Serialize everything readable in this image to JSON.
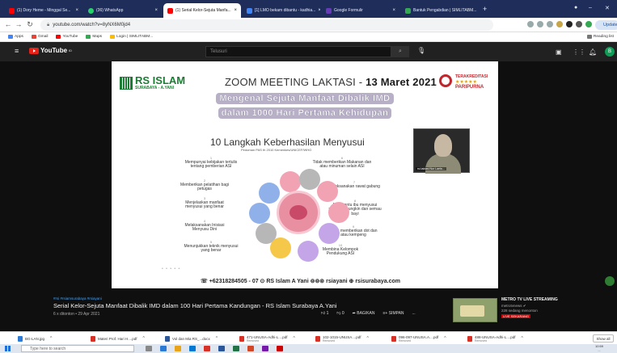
{
  "tabs": [
    {
      "label": "(1) Dory Heme - Minggal Se...",
      "icon_color": "#ff0000",
      "active": false
    },
    {
      "label": "(36) WhatsApp",
      "icon_color": "#25d366",
      "active": false
    },
    {
      "label": "(1) Serial Kelor-Sejuta Manfa...",
      "icon_color": "#ff0000",
      "active": true
    },
    {
      "label": "[1] LMO bekam dibantu - kadhia...",
      "icon_color": "#4285f4",
      "active": false
    },
    {
      "label": "Google Formulir",
      "icon_color": "#673ab7",
      "active": false
    },
    {
      "label": "Bantuk Pengabdian | SIMLITABM...",
      "icon_color": "#34a853",
      "active": false
    }
  ],
  "address": {
    "url": "youtube.com/watch?v=8yNX6M0jd4",
    "update_label": "Update"
  },
  "bookmarks": [
    {
      "label": "Apps",
      "color": "#4285f4"
    },
    {
      "label": "Gmail",
      "color": "#ea4335"
    },
    {
      "label": "YouTube",
      "color": "#ff0000"
    },
    {
      "label": "Maps",
      "color": "#34a853"
    },
    {
      "label": "Login | SIMLITABM...",
      "color": "#fbbc05"
    }
  ],
  "reading_list": "Reading list",
  "youtube": {
    "logo": "YouTube",
    "logo_sup": "ID",
    "search_placeholder": "Telusuri",
    "avatar": "B"
  },
  "slide": {
    "hospital_name": "RS ISLAM",
    "hospital_sub": "SURABAYA - A.YANI",
    "zoom_title_prefix": "ZOOM MEETING LAKTASI - ",
    "zoom_title_date": "13 Maret 2021",
    "accreditation_top": "TERAKREDITASI",
    "accreditation_stars": "★★★★★",
    "accreditation_level": "PARIPURNA",
    "headline_1": "Mengenal Sejuta Manfaat Dibalik IMD",
    "headline_2": "dalam 1000 Hari Pertama Kehidupan",
    "steps_title": "10 Langkah Keberhasilan Menyusui",
    "steps_subtitle": "Pedoman PAS th 2010 Kemenkes/UNICEF/WHO",
    "steps": [
      {
        "n": "1",
        "text": "Mempunyai kebijakan tertulis tentang pemberian ASI"
      },
      {
        "n": "2",
        "text": "Memberikan pelatihan bagi petugas"
      },
      {
        "n": "3",
        "text": "Menjelaskan manfaat menyusui yang benar"
      },
      {
        "n": "4",
        "text": "Melaksanakan Inisiasi Menyusu Dini"
      },
      {
        "n": "5",
        "text": "Menunjukkan teknik menyusui yang benar"
      },
      {
        "n": "6",
        "text": "Tidak memberikan Makanan dan atau minuman selain ASI"
      },
      {
        "n": "7",
        "text": "Melaksanakan rawat gabung"
      },
      {
        "n": "8",
        "text": "Membantu ibu menyusui sesering mungkin dan semau bayi"
      },
      {
        "n": "9",
        "text": "Tidak memberikan dot dan atau kempeng"
      },
      {
        "n": "10",
        "text": "Membina Kelompok Pendukung ASI"
      }
    ],
    "webcam_label": "rsi.laktasi  Nur Laela...",
    "footer": "☏ +62318284505 - 07 ⊙ RS Islam A Yani ⊚⊚⊚ rsiayani ⊕ rsisurabaya.com"
  },
  "video": {
    "hashtag": "#rsi #rsiamsurabaya #rsiayani",
    "title": "Serial Kelor-Sejuta Manfaat Dibalik IMD dalam 100 Hari Pertama Kandungan - RS Islam Surabaya A.Yani",
    "views": "6 x ditonton • 29 Apr 2021",
    "likes": "1",
    "dislikes": "0",
    "share": "BAGIKAN",
    "save": "SIMPAN",
    "more": "..."
  },
  "up_next": {
    "title": "METRO TV LIVE STREAMING",
    "channel": "metrotvnews ✔",
    "watching": "228 sedang menonton",
    "live": "LIVE SEKARANG"
  },
  "downloads": [
    {
      "name": "BG-LAN.jpg",
      "status": "",
      "color": "#2b7bd6"
    },
    {
      "name": "Materi Prof. Hari H....pdf",
      "status": "",
      "color": "#d93025"
    },
    {
      "name": "Vol dan Mia RS_...docx",
      "status": "",
      "color": "#2b579a"
    },
    {
      "name": "471-UNUSA-Adhi-L....pdf",
      "status": "Removed",
      "color": "#d93025"
    },
    {
      "name": "102-1015-UNUSA....pdf",
      "status": "Removed",
      "color": "#d93025"
    },
    {
      "name": "096-097-UNUSA.A....pdf",
      "status": "Removed",
      "color": "#d93025"
    },
    {
      "name": "488-UNUSA-Adhi-L....pdf",
      "status": "Removed",
      "color": "#d93025"
    }
  ],
  "show_all": "Show all",
  "taskbar": {
    "search_placeholder": "Type here to search",
    "time": "10:59",
    "date": "..."
  }
}
